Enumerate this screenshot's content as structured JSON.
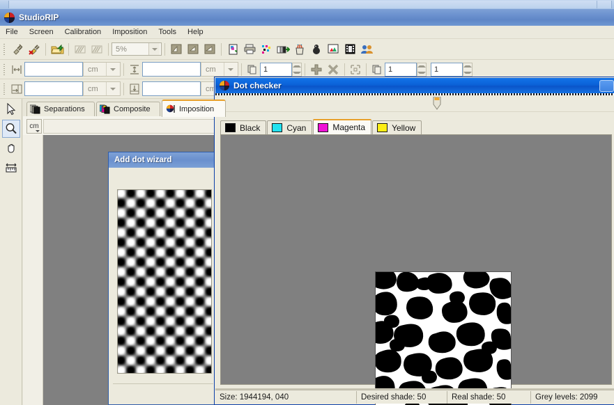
{
  "app": {
    "title": "StudioRIP",
    "icon": "studiorip-registration-icon"
  },
  "menu": {
    "items": [
      {
        "label": "File",
        "name": "menu-file"
      },
      {
        "label": "Screen",
        "name": "menu-screen"
      },
      {
        "label": "Calibration",
        "name": "menu-calibration"
      },
      {
        "label": "Imposition",
        "name": "menu-imposition"
      },
      {
        "label": "Tools",
        "name": "menu-tools"
      },
      {
        "label": "Help",
        "name": "menu-help"
      }
    ]
  },
  "toolbar1": {
    "zoom_value": "5%",
    "buttons": [
      {
        "name": "connect-icon"
      },
      {
        "name": "disconnect-icon"
      },
      {
        "name": "open-folder-icon"
      },
      {
        "name": "render-disabled-icon"
      },
      {
        "name": "render-all-disabled-icon"
      },
      {
        "name": "page-align-left-icon"
      },
      {
        "name": "page-align-center-icon"
      },
      {
        "name": "page-align-right-icon"
      },
      {
        "name": "new-job-icon"
      },
      {
        "name": "print-icon"
      },
      {
        "name": "color-dots-icon"
      },
      {
        "name": "gradient-step-icon"
      },
      {
        "name": "ink-pot-icon"
      },
      {
        "name": "postscript-icon"
      },
      {
        "name": "preview-image-icon"
      },
      {
        "name": "film-icon"
      },
      {
        "name": "users-icon"
      }
    ]
  },
  "toolbar2": {
    "width_value": "",
    "width_unit": "cm",
    "height_value": "",
    "height_unit": "cm",
    "copies_value": "1",
    "rows_value": "1",
    "cols_value": "1",
    "icons": {
      "width": "width-arrows-icon",
      "height": "height-arrows-icon",
      "copies": "copies-icon",
      "add": "add-plus-icon",
      "remove": "remove-cross-icon",
      "crop": "crop-marks-icon",
      "duplicate": "duplicate-icon"
    }
  },
  "toolbar3": {
    "offsetx_value": "",
    "offsetx_unit": "cm",
    "offsety_value": "",
    "offsety_unit": "cm",
    "icons": {
      "offsetx": "offset-x-icon",
      "offsety": "offset-y-icon"
    }
  },
  "tool_palette": {
    "tools": [
      {
        "name": "pointer-tool",
        "icon": "arrow-cursor-icon",
        "selected": false
      },
      {
        "name": "zoom-tool",
        "icon": "magnifier-icon",
        "selected": true
      },
      {
        "name": "pan-tool",
        "icon": "hand-icon",
        "selected": false
      },
      {
        "name": "measure-tool",
        "icon": "ruler-icon",
        "selected": false
      }
    ]
  },
  "document_tabs": [
    {
      "label": "Separations",
      "name": "tab-separations",
      "icon": "separations-icon",
      "active": false
    },
    {
      "label": "Composite",
      "name": "tab-composite",
      "icon": "composite-cmyk-icon",
      "active": false
    },
    {
      "label": "Imposition",
      "name": "tab-imposition",
      "icon": "imposition-icon",
      "active": true
    },
    {
      "label": "",
      "name": "tab-film",
      "icon": "film-strip-icon",
      "active": false
    }
  ],
  "workspace": {
    "unit_button": "cm",
    "unit_caret": "chevron-down-icon"
  },
  "wizard": {
    "title": "Add dot wizard",
    "preview_name": "am-dot-preview"
  },
  "dot_checker": {
    "title": "Dot checker",
    "icon": "studiorip-registration-icon",
    "window_button": "restore-button",
    "slider_thumb": "scale-slider-thumb",
    "color_tabs": [
      {
        "label": "Black",
        "name": "tab-black",
        "color": "#000000",
        "active": false
      },
      {
        "label": "Cyan",
        "name": "tab-cyan",
        "color": "#22e3f0",
        "active": false
      },
      {
        "label": "Magenta",
        "name": "tab-magenta",
        "color": "#ef12d6",
        "active": true
      },
      {
        "label": "Yellow",
        "name": "tab-yellow",
        "color": "#fcee14",
        "active": false
      }
    ],
    "preview_name": "fm-screen-preview",
    "status": [
      {
        "label": "Size: 1944194, 040",
        "name": "status-size"
      },
      {
        "label": "Desired shade: 50",
        "name": "status-desired-shade"
      },
      {
        "label": "Real shade: 50",
        "name": "status-real-shade"
      },
      {
        "label": "Grey levels: 2099",
        "name": "status-grey-levels"
      }
    ]
  },
  "colors": {
    "title_blue": "#6c92cf",
    "dialog_blue": "#0b62d8",
    "accent_orange": "#e8a02a",
    "panel": "#eceadd",
    "canvas_grey": "#808080"
  }
}
